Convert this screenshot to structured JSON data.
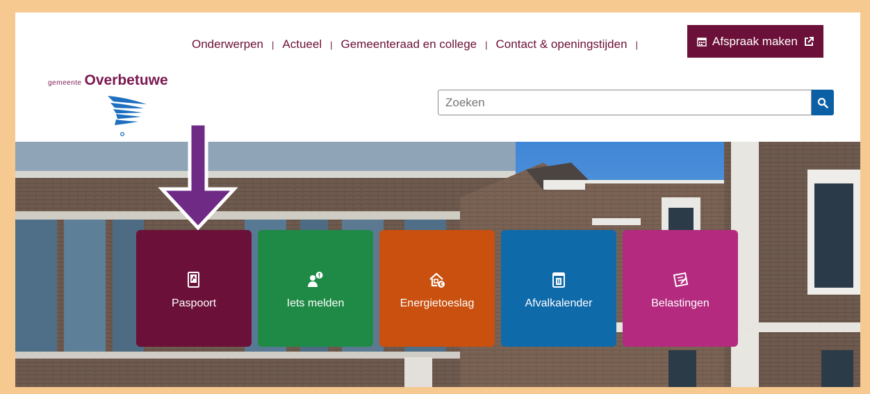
{
  "colors": {
    "frame": "#f5c98f",
    "brand": "#6b1038",
    "search_button": "#0b5fa5",
    "arrow": "#6e2a85"
  },
  "logo": {
    "prefix": "gemeente",
    "name": "Overbetuwe"
  },
  "nav": {
    "items": [
      {
        "label": "Onderwerpen"
      },
      {
        "label": "Actueel"
      },
      {
        "label": "Gemeenteraad en college"
      },
      {
        "label": "Contact & openingstijden"
      }
    ],
    "separator": "|",
    "appointment": {
      "label": "Afspraak maken",
      "icon": "calendar-icon",
      "trailing_icon": "external-link-icon"
    }
  },
  "search": {
    "placeholder": "Zoeken",
    "icon": "search-icon"
  },
  "tiles": [
    {
      "label": "Paspoort",
      "color": "#6b1038",
      "icon": "passport-icon"
    },
    {
      "label": "Iets melden",
      "color": "#1e8a45",
      "icon": "report-person-icon"
    },
    {
      "label": "Energietoeslag",
      "color": "#c9500e",
      "icon": "house-euro-icon"
    },
    {
      "label": "Afvalkalender",
      "color": "#0f6aaa",
      "icon": "waste-calendar-icon"
    },
    {
      "label": "Belastingen",
      "color": "#b32a7f",
      "icon": "tax-form-icon"
    }
  ]
}
